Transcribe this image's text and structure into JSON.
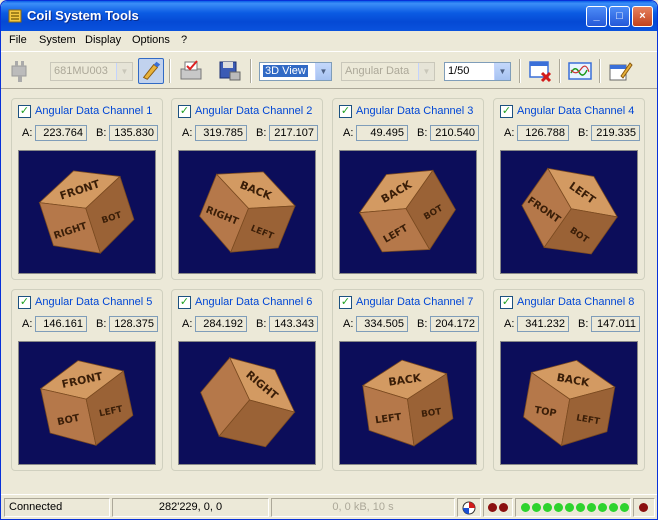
{
  "window": {
    "title": "Coil System Tools"
  },
  "menu": [
    "File",
    "System",
    "Display",
    "Options",
    "?"
  ],
  "toolbar": {
    "device": "681MU003",
    "view_mode": "3D View",
    "data_mode": "Angular Data",
    "rate": "1/50"
  },
  "channels": [
    {
      "label": "Angular Data Channel 1",
      "a_label": "A:",
      "a": "223.764",
      "b_label": "B:",
      "b": "135.830",
      "faces": [
        "FRONT",
        "RIGHT",
        "BOT"
      ]
    },
    {
      "label": "Angular Data Channel 2",
      "a_label": "A:",
      "a": "319.785",
      "b_label": "B:",
      "b": "217.107",
      "faces": [
        "BACK",
        "RIGHT",
        "LEFT"
      ]
    },
    {
      "label": "Angular Data Channel 3",
      "a_label": "A:",
      "a": "49.495",
      "b_label": "B:",
      "b": "210.540",
      "faces": [
        "BACK",
        "LEFT",
        "BOT"
      ]
    },
    {
      "label": "Angular Data Channel 4",
      "a_label": "A:",
      "a": "126.788",
      "b_label": "B:",
      "b": "219.335",
      "faces": [
        "LEFT",
        "FRONT",
        "BOT"
      ]
    },
    {
      "label": "Angular Data Channel 5",
      "a_label": "A:",
      "a": "146.161",
      "b_label": "B:",
      "b": "128.375",
      "faces": [
        "FRONT",
        "BOT",
        "LEFT"
      ]
    },
    {
      "label": "Angular Data Channel 6",
      "a_label": "A:",
      "a": "284.192",
      "b_label": "B:",
      "b": "143.343",
      "faces": [
        "RIGHT",
        "",
        ""
      ]
    },
    {
      "label": "Angular Data Channel 7",
      "a_label": "A:",
      "a": "334.505",
      "b_label": "B:",
      "b": "204.172",
      "faces": [
        "BACK",
        "LEFT",
        "BOT"
      ]
    },
    {
      "label": "Angular Data Channel 8",
      "a_label": "A:",
      "a": "341.232",
      "b_label": "B:",
      "b": "147.011",
      "faces": [
        "BACK",
        "TOP",
        "LEFT"
      ]
    }
  ],
  "status": {
    "connection": "Connected",
    "coords": "282'229, 0, 0",
    "transfer": "0, 0 kB, 10 s"
  },
  "colors": {
    "title_bar": "#0a53dd",
    "channel_label": "#0046d5",
    "view_bg": "#0c0d5a",
    "box_wood": "#b5784a",
    "led_green": "#2ed32e",
    "led_red": "#8b1010"
  }
}
